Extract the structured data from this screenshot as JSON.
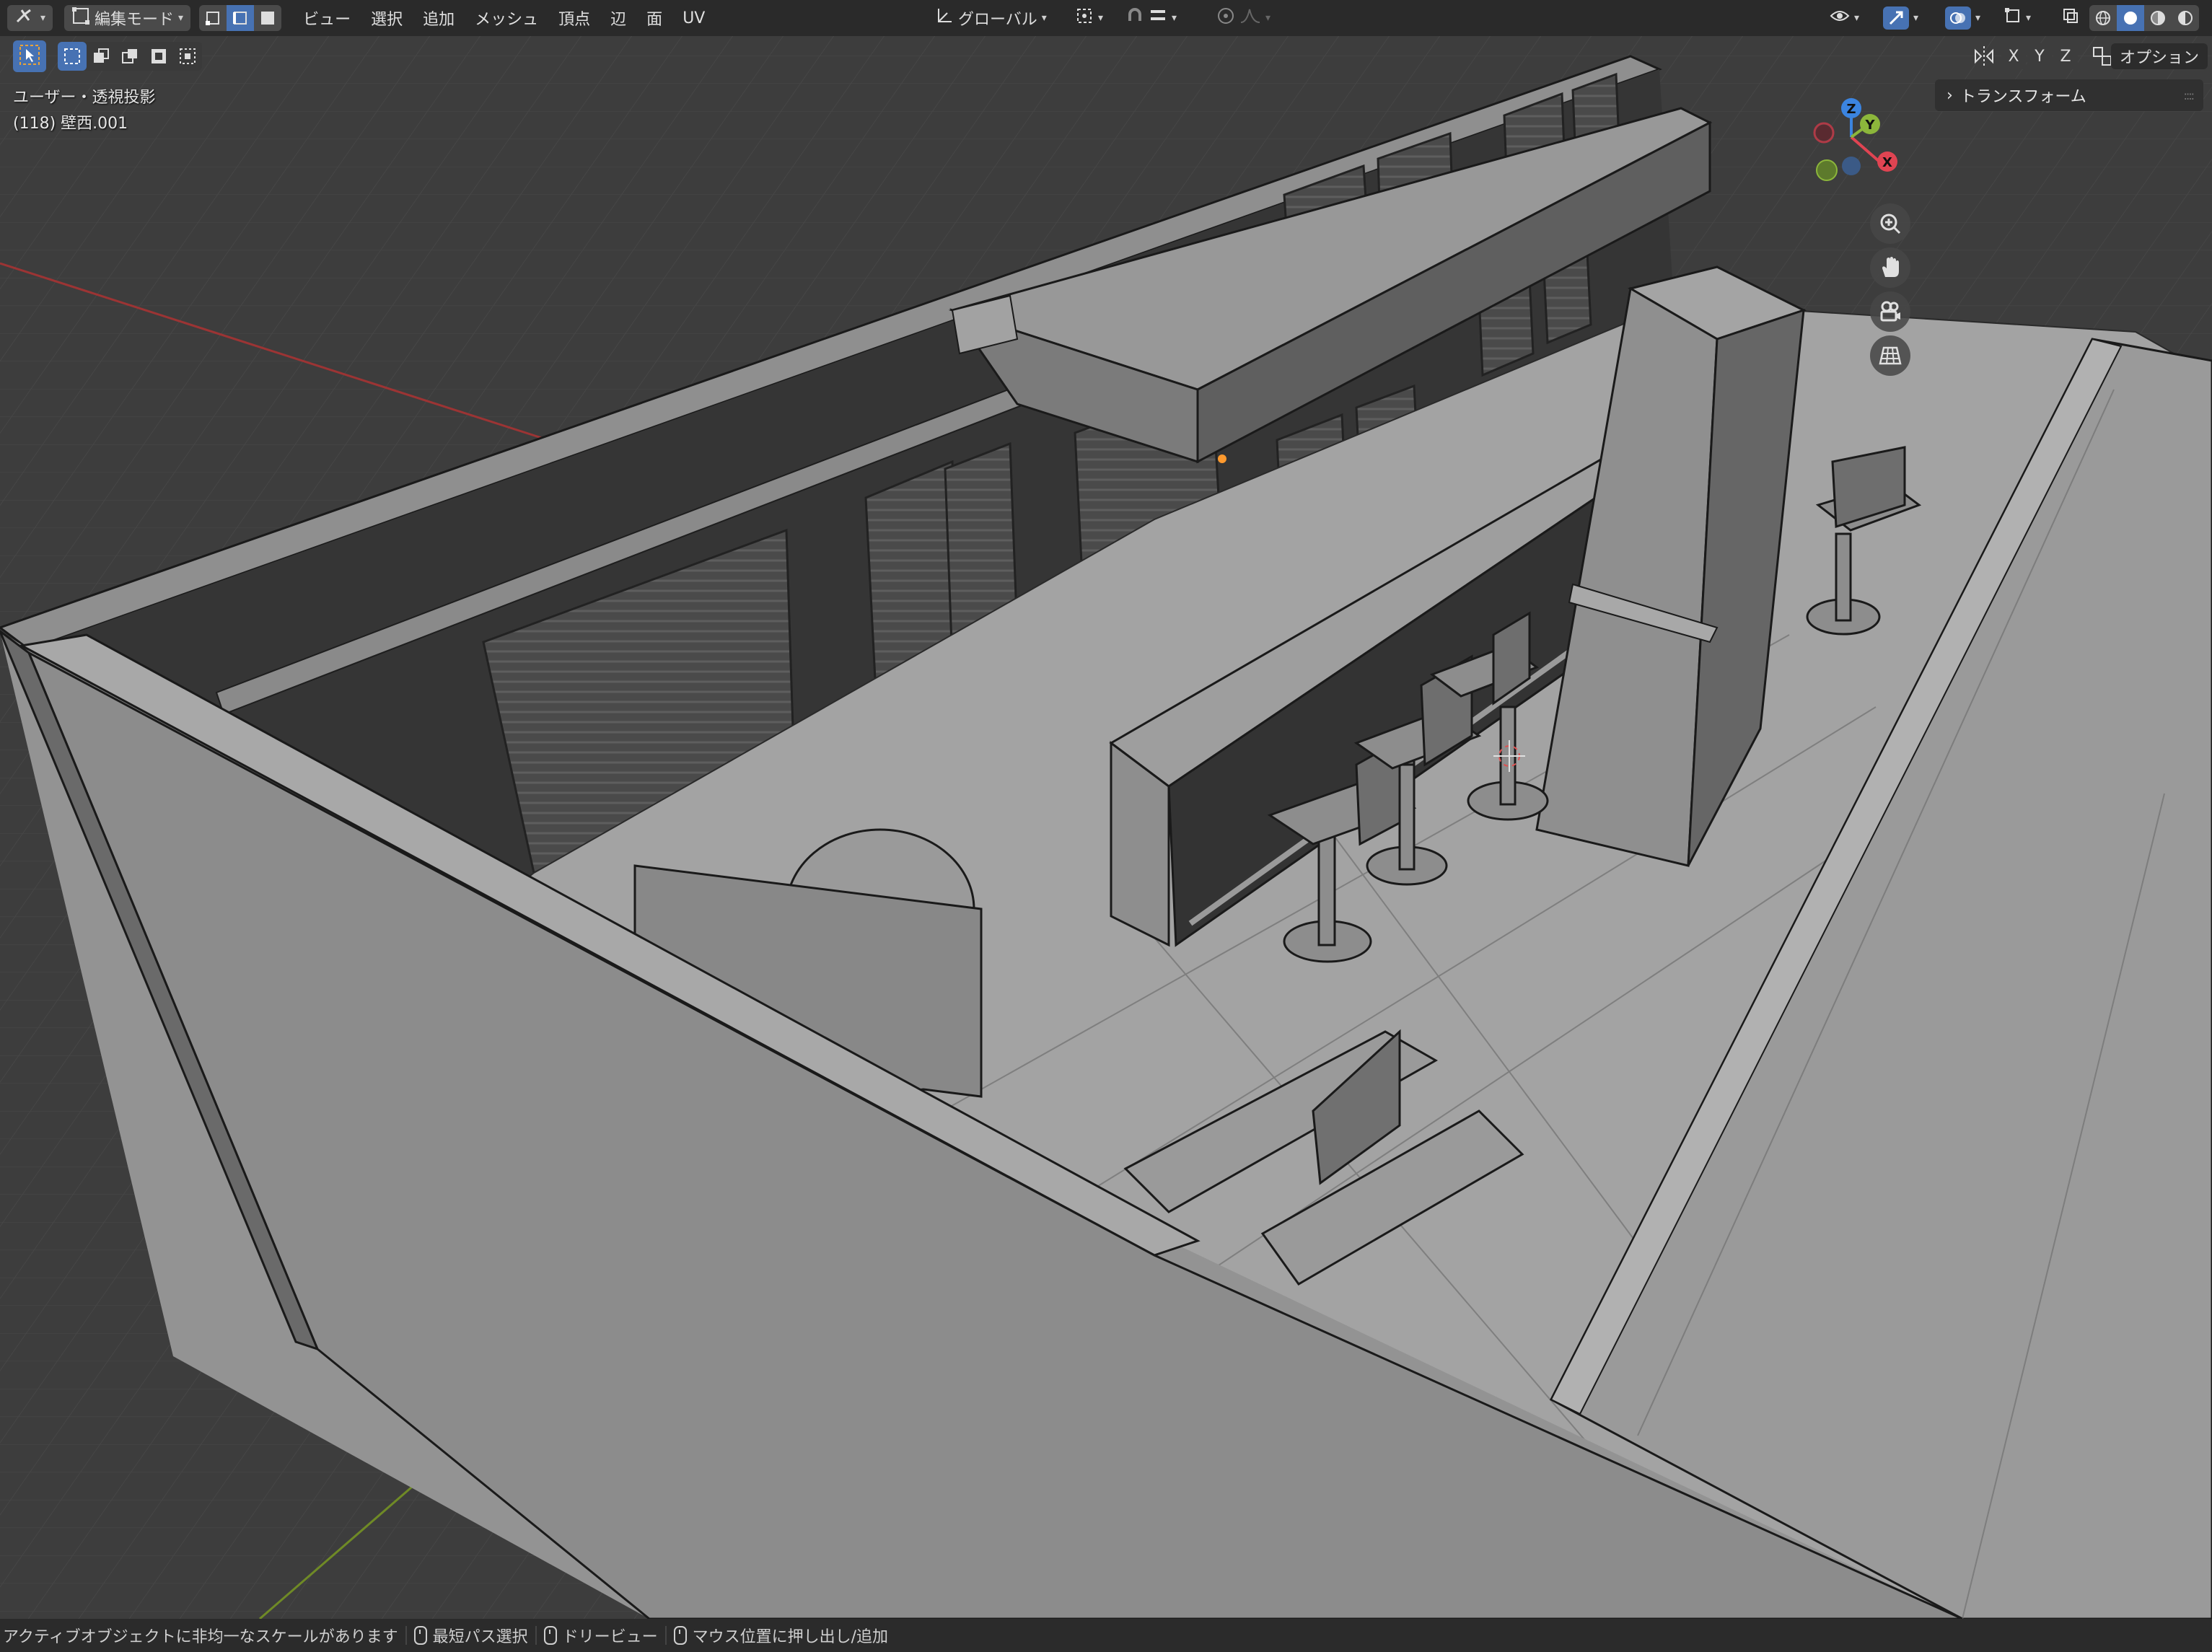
{
  "header": {
    "mode_dropdown_label": "編集モード",
    "menu": [
      "ビュー",
      "選択",
      "追加",
      "メッシュ",
      "頂点",
      "辺",
      "面",
      "UV"
    ],
    "transform_orientation_label": "グローバル"
  },
  "toolbar": {
    "axis_labels": [
      "X",
      "Y",
      "Z"
    ],
    "options_label": "オプション"
  },
  "viewport": {
    "view_name": "ユーザー・透視投影",
    "object_info": "(118) 壁西.001"
  },
  "gizmo": {
    "axis_labels": {
      "z": "Z",
      "y": "Y",
      "x": "X"
    },
    "colors": {
      "x": "#e04452",
      "y": "#8cb63b",
      "z": "#3b84e0"
    }
  },
  "npanel": {
    "tab_label": "トランスフォーム"
  },
  "statusbar": {
    "warning": "アクティブオブジェクトに非均一なスケールがあります",
    "hint1": "最短パス選択",
    "hint2": "ドリービュー",
    "hint3": "マウス位置に押し出し/追加"
  },
  "icons": {
    "editor_type": "editor-type-icon",
    "mode": "edit-mode-icon",
    "select_vertex": "vertex-select-icon",
    "select_edge": "edge-select-icon",
    "select_face": "face-select-icon",
    "zoom": "zoom-icon",
    "pan": "hand-icon",
    "camera": "camera-icon",
    "ortho": "grid-icon"
  },
  "colors": {
    "accent": "#4772b3",
    "header_bg": "#2a2a2a",
    "viewport_bg": "#3d3d3d",
    "grid_x_axis": "#b03a3a",
    "grid_y_axis": "#7c9a2a"
  }
}
